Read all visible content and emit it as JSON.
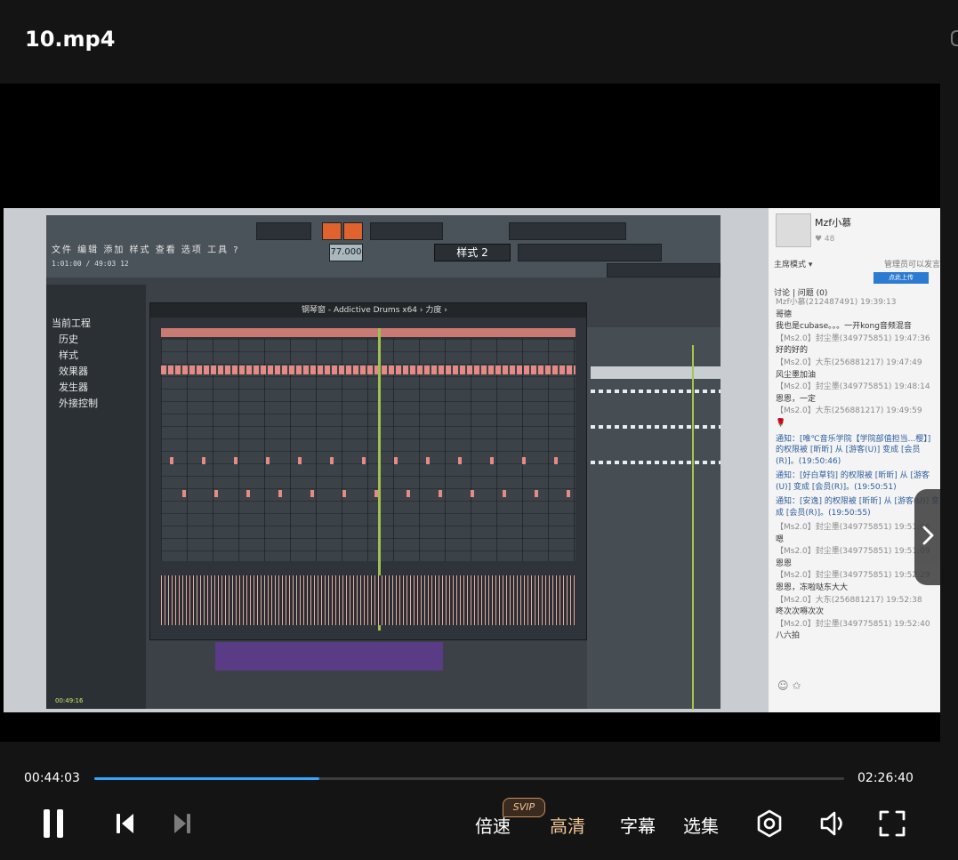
{
  "title": "10.mp4",
  "colors": {
    "accent": "#2fa6ff",
    "active_text": "#f0c496",
    "background": "#141414"
  },
  "video": {
    "fl": {
      "menu": "文件 编辑 添加 样式 查看 选项 工具 ?",
      "time_readout": "1:01:00 / 49:03 12",
      "tempo": "77.000",
      "pattern": "样式 2",
      "browser_items": [
        "当前工程",
        "历史",
        "样式",
        "效果器",
        "发生器",
        "外接控制"
      ],
      "piano_roll_title": "钢琴窗 - Addictive Drums x64 › 力度 ›",
      "clock": "00:49:16"
    },
    "chat": {
      "username": "Mzf小慕",
      "likes": "♥ 48",
      "mode": "主席模式 ▾",
      "admin_note": "管理员可以发言",
      "upload": "点此上传",
      "tabs": "讨论 | 问题 (0)",
      "messages": [
        {
          "type": "meta",
          "text": "Mzf小慕(212487491) 19:39:13"
        },
        {
          "type": "text",
          "text": "哥德"
        },
        {
          "type": "text",
          "text": "我也是cubase。。。一开kong音频混音"
        },
        {
          "type": "meta",
          "text": "【Ms2.0】封尘墨(349775851) 19:47:36"
        },
        {
          "type": "text",
          "text": "好的好的"
        },
        {
          "type": "meta",
          "text": "【Ms2.0】大东(256881217) 19:47:49"
        },
        {
          "type": "text",
          "text": "风尘墨加油"
        },
        {
          "type": "meta",
          "text": "【Ms2.0】封尘墨(349775851) 19:48:14"
        },
        {
          "type": "text",
          "text": "恩恩，一定"
        },
        {
          "type": "meta",
          "text": "【Ms2.0】大东(256881217) 19:49:59"
        },
        {
          "type": "text",
          "text": "🌹"
        },
        {
          "type": "notice",
          "text": "通知：[唯℃音乐学院【学院部值担当...樱】] 的权限被 [昕昕] 从 [游客(U)] 变成 [会员(R)]。(19:50:46)"
        },
        {
          "type": "notice",
          "text": "通知：[好白草钧] 的权限被 [昕昕] 从 [游客(U)] 变成 [会员(R)]。(19:50:51)"
        },
        {
          "type": "notice",
          "text": "通知：[安逸] 的权限被 [昕昕] 从 [游客(U)] 变成 [会员(R)]。(19:50:55)"
        },
        {
          "type": "meta",
          "text": "【Ms2.0】封尘墨(349775851) 19:51:06"
        },
        {
          "type": "text",
          "text": "嗯"
        },
        {
          "type": "meta",
          "text": "【Ms2.0】封尘墨(349775851) 19:51:09"
        },
        {
          "type": "text",
          "text": "恩恩"
        },
        {
          "type": "meta",
          "text": "【Ms2.0】封尘墨(349775851) 19:52:29"
        },
        {
          "type": "text",
          "text": "恩恩，冻啦哒东大大"
        },
        {
          "type": "meta",
          "text": "【Ms2.0】大东(256881217) 19:52:38"
        },
        {
          "type": "text",
          "text": "咚次次嘚次次"
        },
        {
          "type": "meta",
          "text": "【Ms2.0】封尘墨(349775851) 19:52:40"
        },
        {
          "type": "text",
          "text": "八六拍"
        }
      ]
    }
  },
  "player": {
    "current_time": "00:44:03",
    "duration": "02:26:40",
    "progress_percent": 30,
    "speed_label": "倍速",
    "svip_badge": "SVIP",
    "quality_label": "高清",
    "subtitle_label": "字幕",
    "episodes_label": "选集"
  }
}
